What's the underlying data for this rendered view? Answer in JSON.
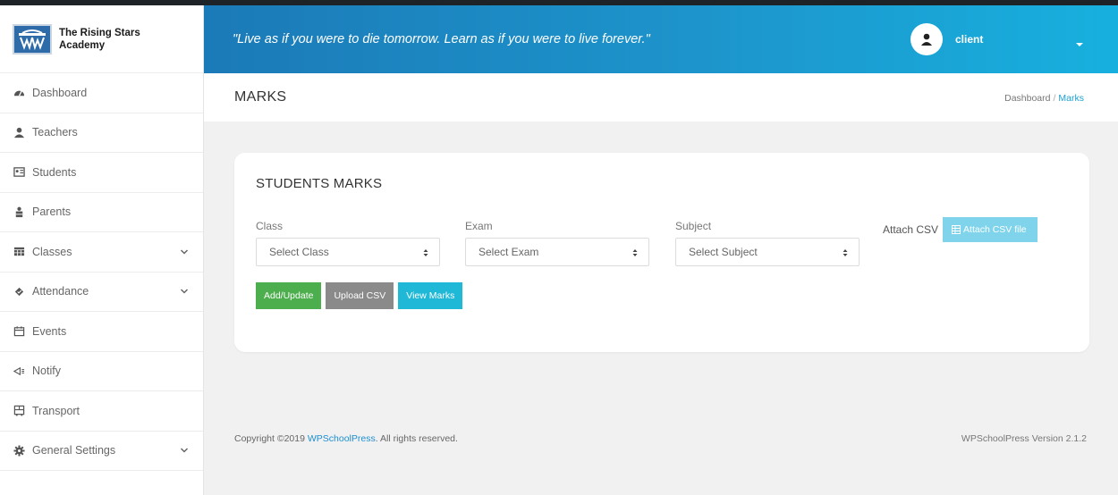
{
  "brand": {
    "name": "The Rising Stars Academy"
  },
  "sidebar": {
    "items": [
      {
        "label": "Dashboard",
        "icon": "dashboard-icon",
        "submenu": false
      },
      {
        "label": "Teachers",
        "icon": "teacher-icon",
        "submenu": false
      },
      {
        "label": "Students",
        "icon": "students-icon",
        "submenu": false
      },
      {
        "label": "Parents",
        "icon": "parents-icon",
        "submenu": false
      },
      {
        "label": "Classes",
        "icon": "classes-icon",
        "submenu": true
      },
      {
        "label": "Attendance",
        "icon": "attendance-icon",
        "submenu": true
      },
      {
        "label": "Events",
        "icon": "calendar-icon",
        "submenu": false
      },
      {
        "label": "Notify",
        "icon": "notify-icon",
        "submenu": false
      },
      {
        "label": "Transport",
        "icon": "transport-icon",
        "submenu": false
      },
      {
        "label": "General Settings",
        "icon": "gear-icon",
        "submenu": true
      }
    ]
  },
  "header": {
    "quote": "\"Live as if you were to die tomorrow. Learn as if you were to live forever.\"",
    "username": "client"
  },
  "page": {
    "title": "MARKS",
    "breadcrumb": {
      "home": "Dashboard",
      "separator": "/",
      "current": "Marks"
    }
  },
  "card": {
    "title": "STUDENTS MARKS",
    "fields": {
      "class": {
        "label": "Class",
        "value": "Select Class"
      },
      "exam": {
        "label": "Exam",
        "value": "Select Exam"
      },
      "subject": {
        "label": "Subject",
        "value": "Select Subject"
      }
    },
    "attach": {
      "label": "Attach CSV",
      "button": "Attach CSV file"
    },
    "buttons": {
      "add_update": "Add/Update",
      "upload_csv": "Upload CSV",
      "view_marks": "View Marks"
    }
  },
  "footer": {
    "copyright_prefix": "Copyright ©2019 ",
    "link": "WPSchoolPress",
    "copyright_suffix": ". All rights reserved.",
    "version": "WPSchoolPress Version 2.1.2"
  },
  "colors": {
    "header_start": "#1b7ab8",
    "header_end": "#17b0de",
    "btn_green": "#4cae4c",
    "btn_gray": "#8a8a8a",
    "btn_cyan": "#1fb8d6",
    "attach_btn": "#7fd4ec",
    "link": "#1e8fcf"
  }
}
